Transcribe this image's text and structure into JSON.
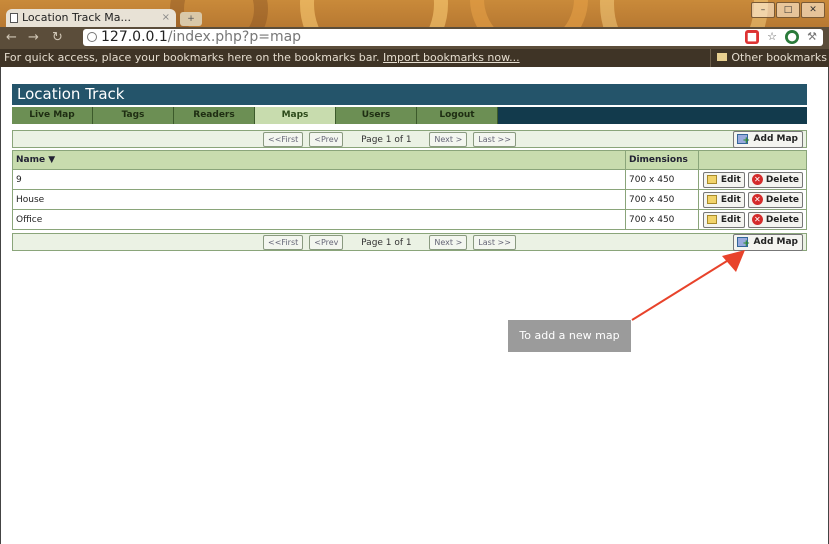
{
  "browser": {
    "tab_title": "Location Track  Ma...",
    "tab_close": "×",
    "new_tab": "+",
    "url_host": "127.0.0.1",
    "url_path": "/index.php?p=map",
    "bookmarks_prompt": "For quick access, place your bookmarks here on the bookmarks bar.",
    "import_link": "Import bookmarks now...",
    "other_bookmarks": "Other bookmarks",
    "window_buttons": [
      "–",
      "□",
      "✕"
    ]
  },
  "app": {
    "title": "Location Track",
    "nav": [
      "Live Map",
      "Tags",
      "Readers",
      "Maps",
      "Users",
      "Logout"
    ],
    "active_nav": "Maps"
  },
  "pager": {
    "first": "<<First",
    "prev": "<Prev",
    "info": "Page 1 of 1",
    "next": "Next >",
    "last": "Last >>"
  },
  "add_map_label": "Add Map",
  "table": {
    "col_name": "Name ▼",
    "col_dims": "Dimensions",
    "rows": [
      {
        "name": "9",
        "dims": "700 x 450"
      },
      {
        "name": "House",
        "dims": "700 x 450"
      },
      {
        "name": "Office",
        "dims": "700 x 450"
      }
    ],
    "edit_label": "Edit",
    "delete_label": "Delete"
  },
  "annotation": {
    "text": "To add a new map",
    "color": "#e8432b"
  }
}
